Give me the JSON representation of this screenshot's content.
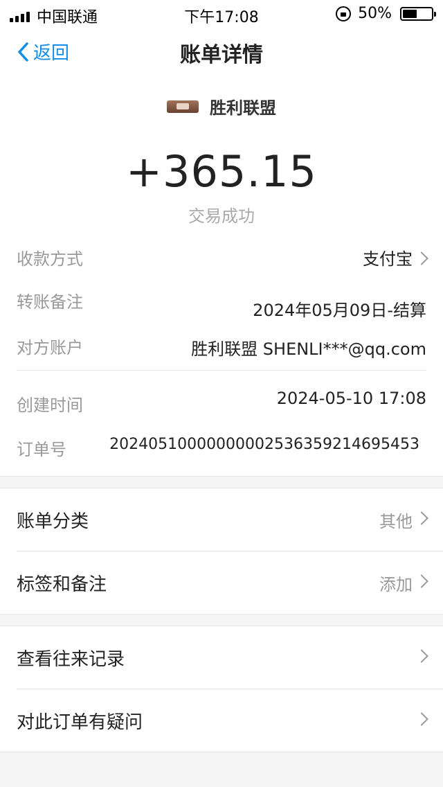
{
  "status_bar": {
    "carrier": "中国联通",
    "time": "下午17:08",
    "battery": "50%",
    "battery_level": 0.5
  },
  "nav": {
    "back_label": "返回",
    "title": "账单详情"
  },
  "summary": {
    "merchant": "胜利联盟",
    "amount": "+365.15",
    "status": "交易成功"
  },
  "details": [
    {
      "label": "收款方式",
      "value": "支付宝"
    },
    {
      "label": "转账备注",
      "value": "2024年05月09日-结算"
    },
    {
      "label": "对方账户",
      "value": "胜利联盟 SHENLI***@qq.com"
    },
    {
      "label": "创建时间",
      "value": "2024-05-10 17:08"
    },
    {
      "label": "订单号",
      "value": "20240510000000002536359214695453"
    }
  ],
  "section1": [
    {
      "label": "账单分类",
      "value": "其他"
    },
    {
      "label": "标签和备注",
      "value": "添加"
    }
  ],
  "section2": [
    {
      "label": "查看往来记录"
    },
    {
      "label": "对此订单有疑问"
    }
  ],
  "colors": {
    "accent": "#108ee9",
    "background": "#f5f5f5"
  }
}
